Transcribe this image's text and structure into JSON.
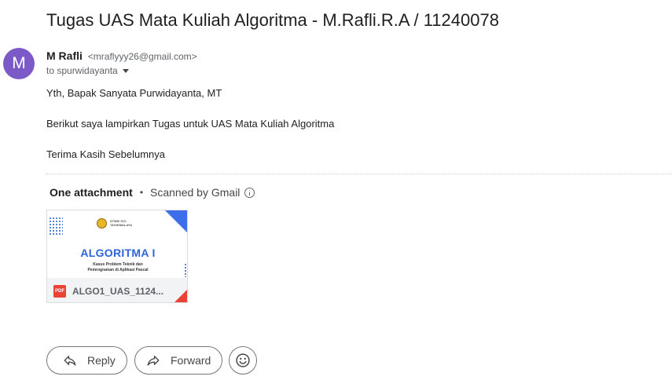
{
  "email": {
    "subject": "Tugas UAS Mata Kuliah Algoritma - M.Rafli.R.A / 11240078",
    "avatar_letter": "M",
    "avatar_color": "#7b5ac8",
    "sender_name": "M Rafli",
    "sender_email": "<mraflyyy26@gmail.com>",
    "recipient": "to spurwidayanta",
    "body": [
      "Yth, Bapak Sanyata Purwidayanta, MT",
      "Berikut saya lampirkan Tugas untuk UAS Mata Kuliah Algoritma",
      "Terima Kasih Sebelumnya"
    ]
  },
  "attachments": {
    "count_label": "One attachment",
    "separator": "•",
    "scan_label": "Scanned by Gmail",
    "items": [
      {
        "file_type_badge": "PDF",
        "filename": "ALGO1_UAS_1124...",
        "preview": {
          "org": "STMIK DCI\nTASIKMALAYA",
          "title": "ALGORITMA I",
          "subtitle": "Kasus Problem Teknik dan\nPemrograman di Aplikasi Pascal"
        }
      }
    ]
  },
  "actions": {
    "reply_label": "Reply",
    "forward_label": "Forward"
  },
  "icons": {
    "reply": "reply-arrow-icon",
    "forward": "forward-arrow-icon",
    "emoji": "smiley-icon",
    "info": "info-icon",
    "pdf": "pdf-icon",
    "dropdown": "chevron-down-icon"
  },
  "colors": {
    "accent_blue": "#2e63d9",
    "pdf_red": "#ea4335"
  }
}
